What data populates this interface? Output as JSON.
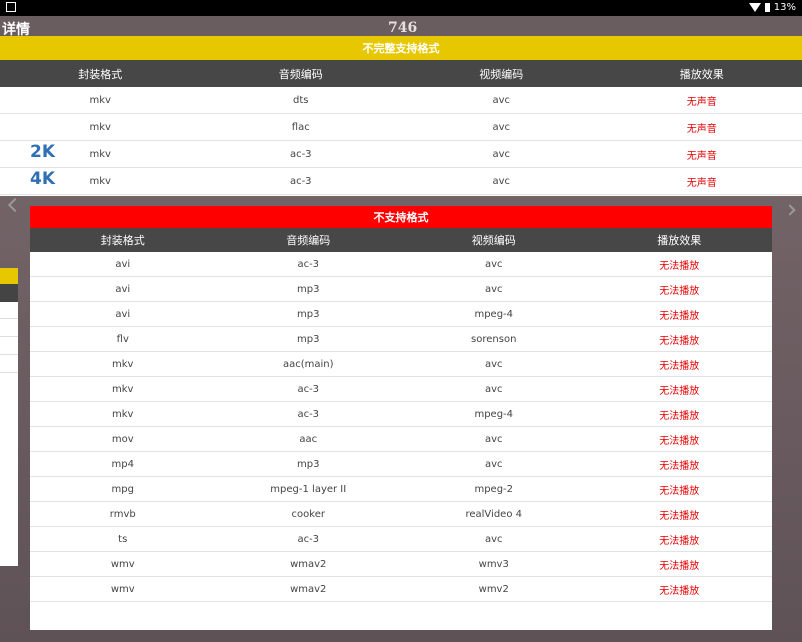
{
  "status_bar": {
    "battery_text": "13%"
  },
  "background": {
    "title_left": "详情",
    "title_center": "746"
  },
  "partial": {
    "title": "不完整支持格式",
    "headers": [
      "封装格式",
      "音频编码",
      "视频编码",
      "播放效果"
    ],
    "rows": [
      [
        "mkv",
        "dts",
        "avc",
        "无声音"
      ],
      [
        "mkv",
        "flac",
        "avc",
        "无声音"
      ],
      [
        "mkv",
        "ac-3",
        "avc",
        "无声音"
      ],
      [
        "mkv",
        "ac-3",
        "avc",
        "无声音"
      ]
    ],
    "badges": [
      "2K",
      "4K"
    ]
  },
  "unsupported": {
    "title": "不支持格式",
    "headers": [
      "封装格式",
      "音频编码",
      "视频编码",
      "播放效果"
    ],
    "rows": [
      [
        "avi",
        "ac-3",
        "avc",
        "无法播放"
      ],
      [
        "avi",
        "mp3",
        "avc",
        "无法播放"
      ],
      [
        "avi",
        "mp3",
        "mpeg-4",
        "无法播放"
      ],
      [
        "flv",
        "mp3",
        "sorenson",
        "无法播放"
      ],
      [
        "mkv",
        "aac(main)",
        "avc",
        "无法播放"
      ],
      [
        "mkv",
        "ac-3",
        "avc",
        "无法播放"
      ],
      [
        "mkv",
        "ac-3",
        "mpeg-4",
        "无法播放"
      ],
      [
        "mov",
        "aac",
        "avc",
        "无法播放"
      ],
      [
        "mp4",
        "mp3",
        "avc",
        "无法播放"
      ],
      [
        "mpg",
        "mpeg-1 layer II",
        "mpeg-2",
        "无法播放"
      ],
      [
        "rmvb",
        "cooker",
        "realVideo 4",
        "无法播放"
      ],
      [
        "ts",
        "ac-3",
        "avc",
        "无法播放"
      ],
      [
        "wmv",
        "wmav2",
        "wmv3",
        "无法播放"
      ],
      [
        "wmv",
        "wmav2",
        "wmv2",
        "无法播放"
      ]
    ]
  },
  "colors": {
    "yellow_header": "#e7c800",
    "red_header": "#ff0000",
    "table_head": "#474747",
    "effect_text": "#e60000",
    "badge": "#2f6fb4"
  }
}
